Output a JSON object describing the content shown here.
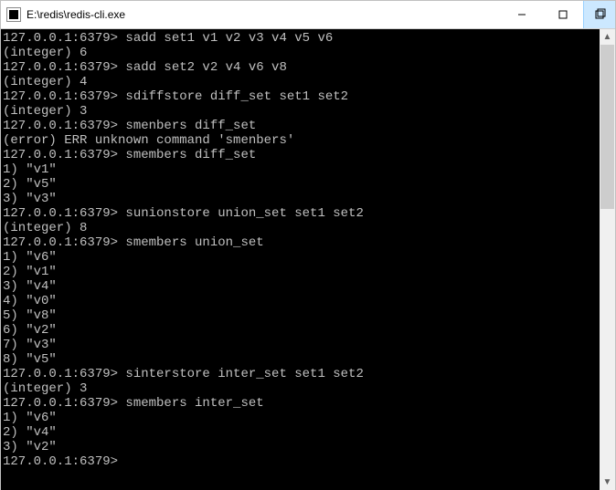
{
  "window": {
    "title": "E:\\redis\\redis-cli.exe"
  },
  "prompt": "127.0.0.1:6379>",
  "lines": [
    {
      "type": "cmd",
      "text": "sadd set1 v1 v2 v3 v4 v5 v6"
    },
    {
      "type": "out",
      "text": "(integer) 6"
    },
    {
      "type": "cmd",
      "text": "sadd set2 v2 v4 v6 v8"
    },
    {
      "type": "out",
      "text": "(integer) 4"
    },
    {
      "type": "cmd",
      "text": "sdiffstore diff_set set1 set2"
    },
    {
      "type": "out",
      "text": "(integer) 3"
    },
    {
      "type": "cmd",
      "text": "smenbers diff_set"
    },
    {
      "type": "out",
      "text": "(error) ERR unknown command 'smenbers'"
    },
    {
      "type": "cmd",
      "text": "smembers diff_set"
    },
    {
      "type": "out",
      "text": "1) \"v1\""
    },
    {
      "type": "out",
      "text": "2) \"v5\""
    },
    {
      "type": "out",
      "text": "3) \"v3\""
    },
    {
      "type": "cmd",
      "text": "sunionstore union_set set1 set2"
    },
    {
      "type": "out",
      "text": "(integer) 8"
    },
    {
      "type": "cmd",
      "text": "smembers union_set"
    },
    {
      "type": "out",
      "text": "1) \"v6\""
    },
    {
      "type": "out",
      "text": "2) \"v1\""
    },
    {
      "type": "out",
      "text": "3) \"v4\""
    },
    {
      "type": "out",
      "text": "4) \"v0\""
    },
    {
      "type": "out",
      "text": "5) \"v8\""
    },
    {
      "type": "out",
      "text": "6) \"v2\""
    },
    {
      "type": "out",
      "text": "7) \"v3\""
    },
    {
      "type": "out",
      "text": "8) \"v5\""
    },
    {
      "type": "cmd",
      "text": "sinterstore inter_set set1 set2"
    },
    {
      "type": "out",
      "text": "(integer) 3"
    },
    {
      "type": "cmd",
      "text": "smembers inter_set"
    },
    {
      "type": "out",
      "text": "1) \"v6\""
    },
    {
      "type": "out",
      "text": "2) \"v4\""
    },
    {
      "type": "out",
      "text": "3) \"v2\""
    },
    {
      "type": "cmd",
      "text": ""
    }
  ]
}
